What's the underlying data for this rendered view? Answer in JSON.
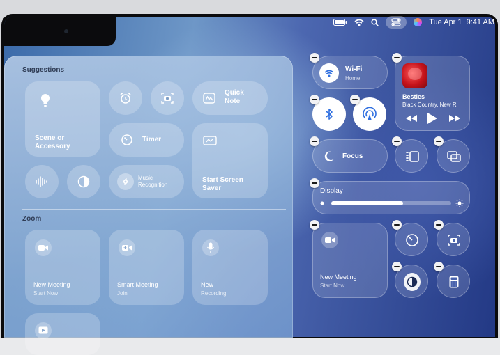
{
  "menubar": {
    "datetime": "Tue Apr 1  9:41 AM"
  },
  "left_panel": {
    "suggestions_title": "Suggestions",
    "zoom_title": "Zoom",
    "scene_label": "Scene or\nAccessory",
    "quick_note_label": "Quick\nNote",
    "timer_label": "Timer",
    "music_recognition_label": "Music\nRecognition",
    "screen_saver_label": "Start Screen\nSaver",
    "zoom_tiles": [
      {
        "title": "New Meeting",
        "sub": "Start Now"
      },
      {
        "title": "Smart Meeting",
        "sub": "Join"
      },
      {
        "title": "New",
        "sub": "Recording"
      }
    ]
  },
  "control_center": {
    "wifi_label": "Wi-Fi",
    "wifi_network": "Home",
    "now_playing_title": "Besties",
    "now_playing_artist": "Black Country, New R",
    "focus_label": "Focus",
    "display_label": "Display",
    "display_brightness": 0.6,
    "meeting_title": "New Meeting",
    "meeting_sub": "Start Now"
  }
}
